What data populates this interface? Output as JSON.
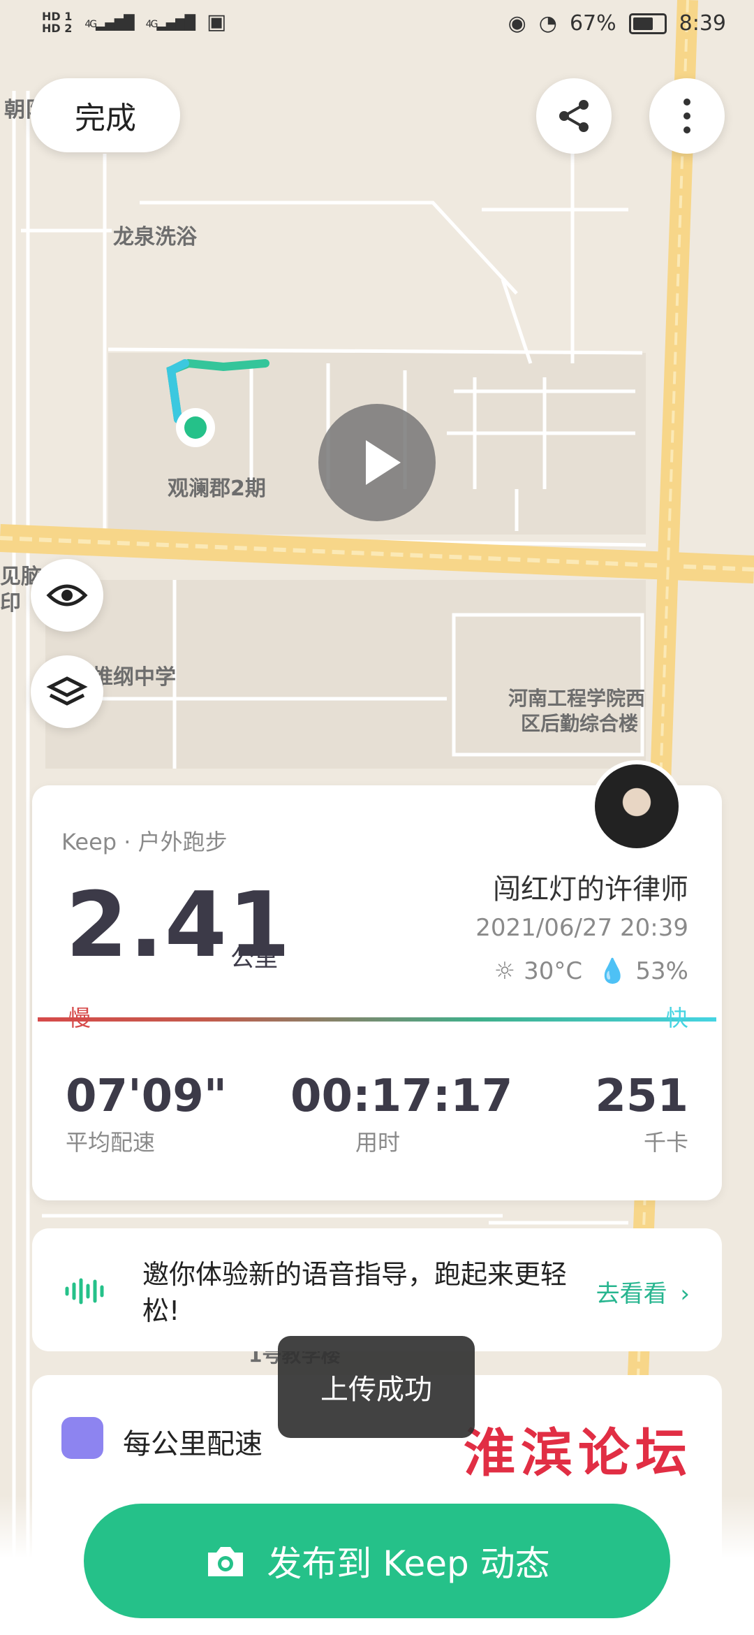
{
  "status_bar": {
    "hd1": "HD 1",
    "hd2": "HD 2",
    "net1": "4G",
    "net2": "4G",
    "battery": "67%",
    "time": "8:39"
  },
  "top_bar": {
    "done_label": "完成"
  },
  "map": {
    "labels": {
      "l1": "朝阝",
      "l2": "龙泉洗浴",
      "l3": "观澜郡2期",
      "l4": "见脑",
      "l5": "印",
      "l6": "推纲中学",
      "l7a": "河南工程学院西",
      "l7b": "区后勤综合楼",
      "l8": "1号教学楼"
    }
  },
  "summary": {
    "brand": "Keep · 户外跑步",
    "distance": "2.41",
    "distance_unit": "公里",
    "username": "闯红灯的许律师",
    "datetime": "2021/06/27 20:39",
    "temperature": "30°C",
    "humidity": "53%",
    "slow_label": "慢",
    "fast_label": "快",
    "stats": {
      "pace_value": "07'09\"",
      "pace_label": "平均配速",
      "time_value": "00:17:17",
      "time_label": "用时",
      "cal_value": "251",
      "cal_label": "千卡"
    }
  },
  "voice_banner": {
    "text": "邀你体验新的语音指导，跑起来更轻松!",
    "action": "去看看"
  },
  "pace_card": {
    "title": "每公里配速"
  },
  "toast": {
    "text": "上传成功"
  },
  "watermark": {
    "text": "淮滨论坛"
  },
  "publish": {
    "label": "发布到 Keep 动态"
  },
  "colors": {
    "accent_green": "#25c189",
    "pace_slow": "#d64a4a",
    "pace_fast": "#45d4e2",
    "watermark_red": "#e0233b"
  }
}
